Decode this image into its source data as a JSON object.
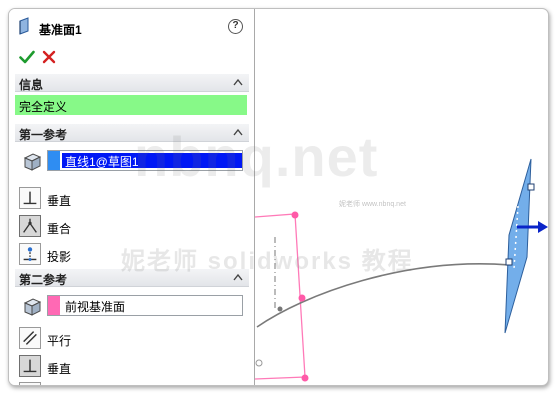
{
  "window": {
    "title": "基准面1"
  },
  "header": {
    "help_glyph": "?"
  },
  "actions": {
    "ok_icon": "check-icon",
    "cancel_icon": "close-icon"
  },
  "sections": {
    "info": {
      "title": "信息",
      "status": "完全定义",
      "status_color": "#87f988"
    },
    "first_ref": {
      "title": "第一参考",
      "selection": "直线1@草图1",
      "options": [
        "垂直",
        "重合",
        "投影"
      ]
    },
    "second_ref": {
      "title": "第二参考",
      "selection": "前视基准面",
      "swatch_color": "#ff69b4",
      "options": [
        "平行",
        "垂直"
      ]
    }
  },
  "watermark": {
    "site": "nbnq.net",
    "small": "妮老师 www.nbnq.net",
    "caption": "妮老师 solidworks 教程"
  }
}
